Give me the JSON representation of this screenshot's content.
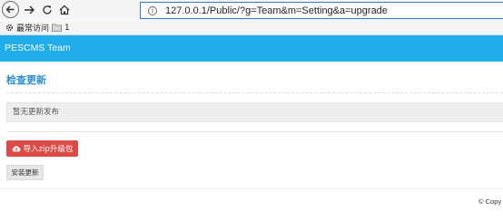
{
  "browser": {
    "url": "127.0.0.1/Public/?g=Team&m=Setting&a=upgrade",
    "bookmarks": [
      {
        "label": "最常访问",
        "icon": "gear-icon"
      },
      {
        "label": "1",
        "icon": "folder-icon"
      }
    ]
  },
  "header": {
    "brand": "PESCMS Team",
    "background_color": "#1fadeb"
  },
  "main": {
    "title": "检查更新",
    "notice": "暂无更新发布",
    "import_button": {
      "label": "导入zip升级包",
      "icon": "cloud-upload-icon",
      "color": "#dd4b47"
    },
    "install_button": {
      "label": "安装更新"
    }
  },
  "footer": {
    "copyright": "© Copy"
  }
}
